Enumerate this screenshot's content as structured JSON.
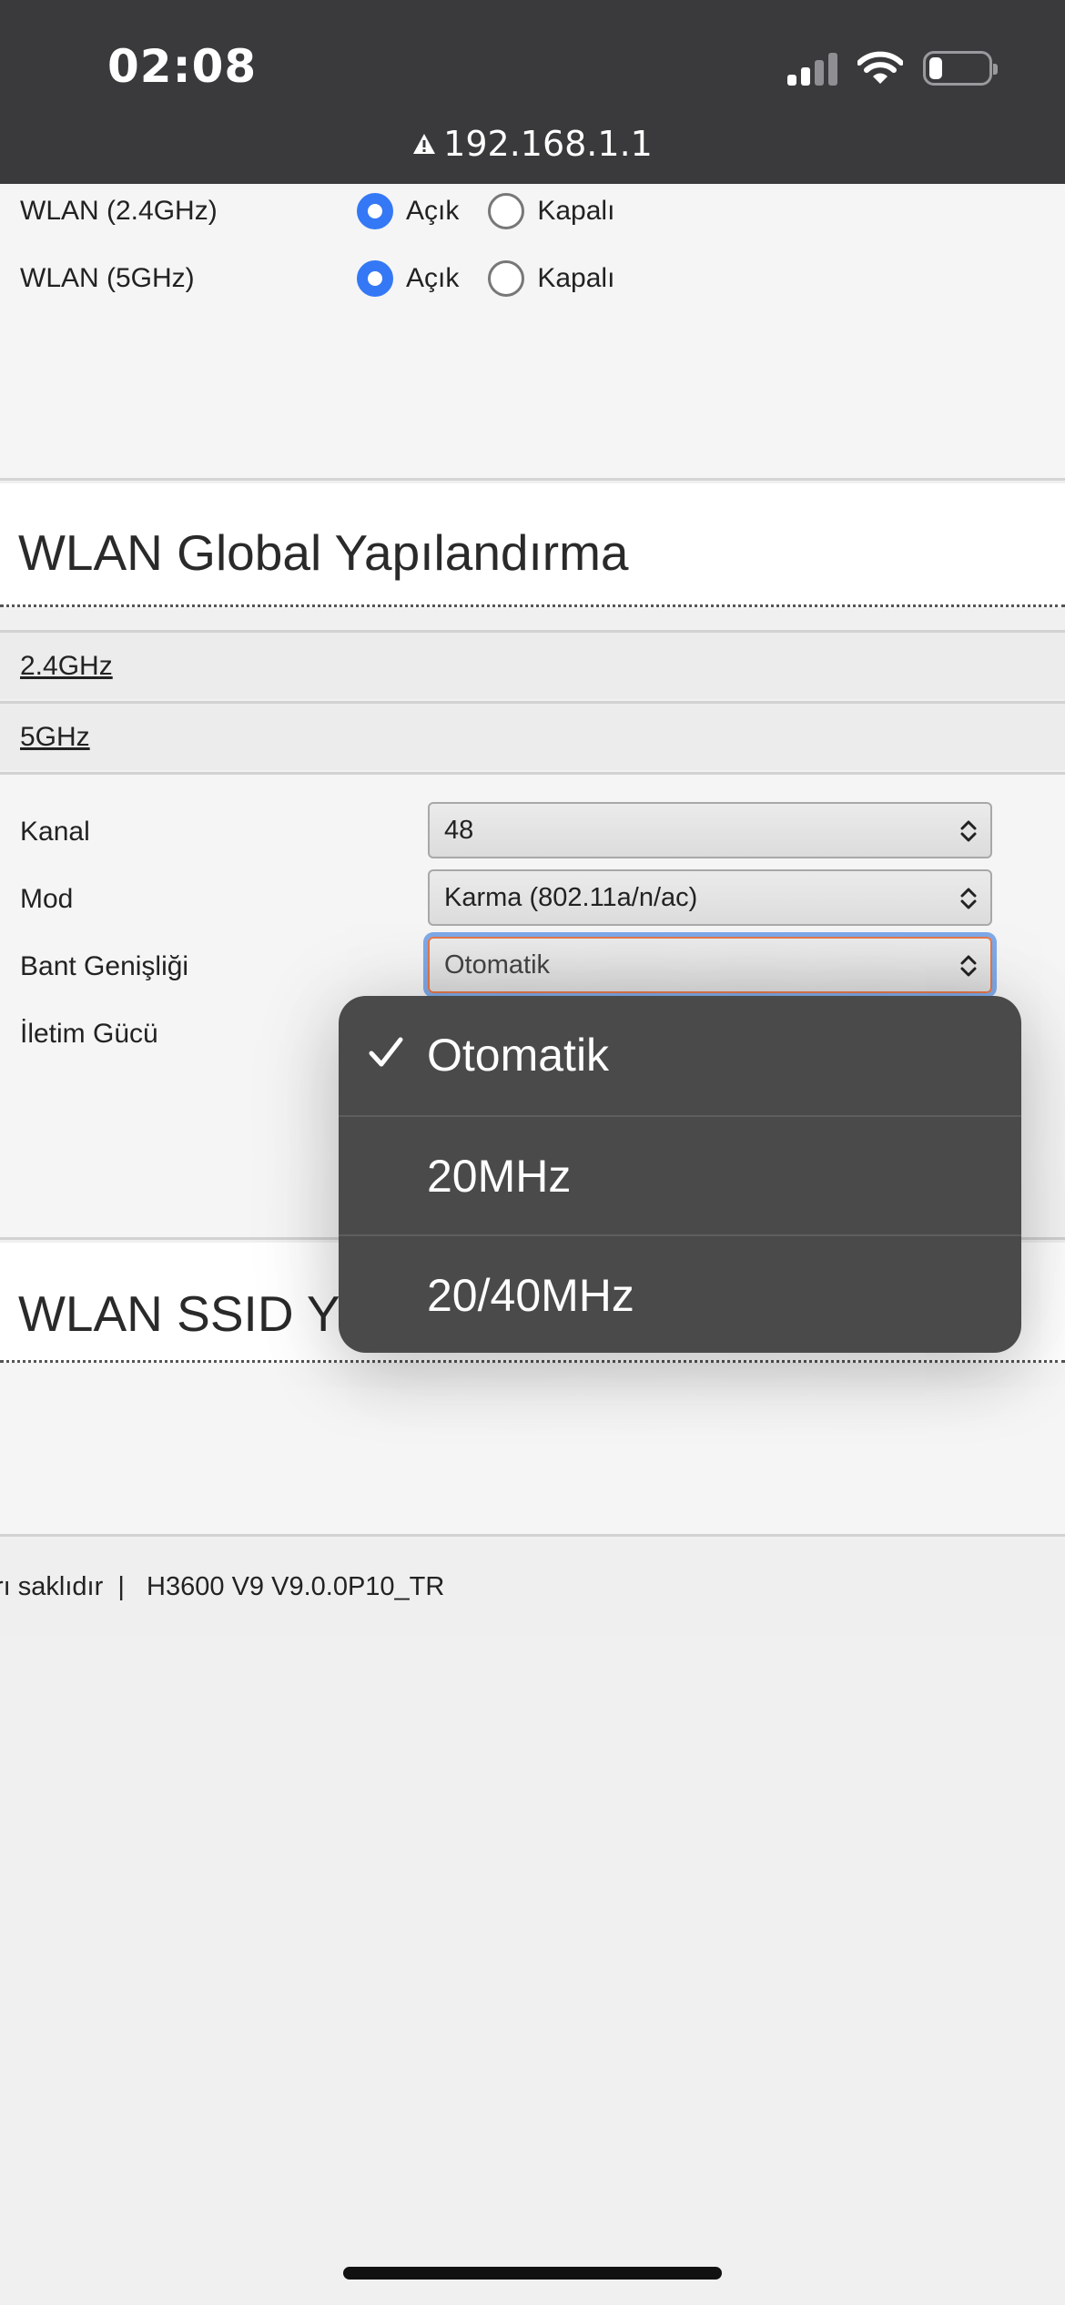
{
  "status_bar": {
    "time": "02:08",
    "address": "192.168.1.1"
  },
  "wlan_toggles": [
    {
      "label": "WLAN (2.4GHz)",
      "on_label": "Açık",
      "off_label": "Kapalı",
      "selected": "on"
    },
    {
      "label": "WLAN (5GHz)",
      "on_label": "Açık",
      "off_label": "Kapalı",
      "selected": "on"
    }
  ],
  "global_section": {
    "title": "WLAN Global Yapılandırma",
    "bands": [
      "2.4GHz",
      "5GHz"
    ]
  },
  "config": {
    "channel": {
      "label": "Kanal",
      "value": "48"
    },
    "mode": {
      "label": "Mod",
      "value": "Karma (802.11a/n/ac)"
    },
    "bandwidth": {
      "label": "Bant Genişliği",
      "value": "Otomatik"
    },
    "tx_power": {
      "label": "İletim Gücü"
    }
  },
  "ssid_section": {
    "title": "WLAN SSID Y"
  },
  "footer": {
    "text": "rı saklıdır  |   H3600 V9 V9.0.0P10_TR"
  },
  "dropdown": {
    "options": [
      {
        "label": "Otomatik",
        "selected": true
      },
      {
        "label": "20MHz",
        "selected": false
      },
      {
        "label": "20/40MHz",
        "selected": false
      }
    ]
  },
  "colors": {
    "accent": "#3478f6",
    "status_bar": "#3a3a3c",
    "dropdown_bg": "#4a4a4a",
    "focus_ring": "#7ea9e8"
  }
}
